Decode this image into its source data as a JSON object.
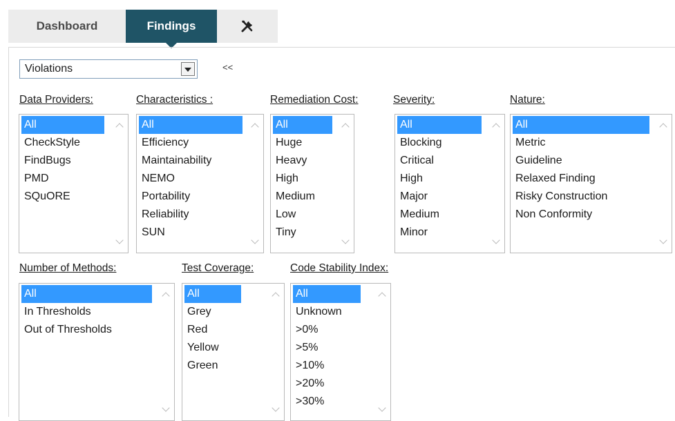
{
  "tabs": {
    "dashboard": "Dashboard",
    "findings": "Findings",
    "tools_icon": "tools-icon"
  },
  "view_selector": {
    "value": "Violations",
    "collapse_label": "<<"
  },
  "filters": {
    "data_providers": {
      "label": "Data Providers:",
      "options": [
        "All",
        "CheckStyle",
        "FindBugs",
        "PMD",
        "SQuORE"
      ],
      "selected": "All"
    },
    "characteristics": {
      "label": "Characteristics :",
      "options": [
        "All",
        "Efficiency",
        "Maintainability",
        "NEMO",
        "Portability",
        "Reliability",
        "SUN"
      ],
      "selected": "All"
    },
    "remediation_cost": {
      "label": "Remediation Cost:",
      "options": [
        "All",
        "Huge",
        "Heavy",
        "High",
        "Medium",
        "Low",
        "Tiny"
      ],
      "selected": "All"
    },
    "severity": {
      "label": "Severity:",
      "options": [
        "All",
        "Blocking",
        "Critical",
        "High",
        "Major",
        "Medium",
        "Minor"
      ],
      "selected": "All"
    },
    "nature": {
      "label": "Nature:",
      "options": [
        "All",
        "Metric",
        "Guideline",
        "Relaxed Finding",
        "Risky Construction",
        "Non Conformity"
      ],
      "selected": "All"
    },
    "number_of_methods": {
      "label": "Number of Methods:",
      "options": [
        "All",
        "In Thresholds",
        "Out of Thresholds"
      ],
      "selected": "All"
    },
    "test_coverage": {
      "label": "Test Coverage:",
      "options": [
        "All",
        "Grey",
        "Red",
        "Yellow",
        "Green"
      ],
      "selected": "All"
    },
    "code_stability_index": {
      "label": "Code Stability Index:",
      "options": [
        "All",
        "Unknown",
        ">0%",
        ">5%",
        ">10%",
        ">20%",
        ">30%"
      ],
      "selected": "All"
    }
  },
  "colors": {
    "active_tab": "#1f5466",
    "selection": "#3399ff",
    "inactive_tab": "#ececec"
  }
}
